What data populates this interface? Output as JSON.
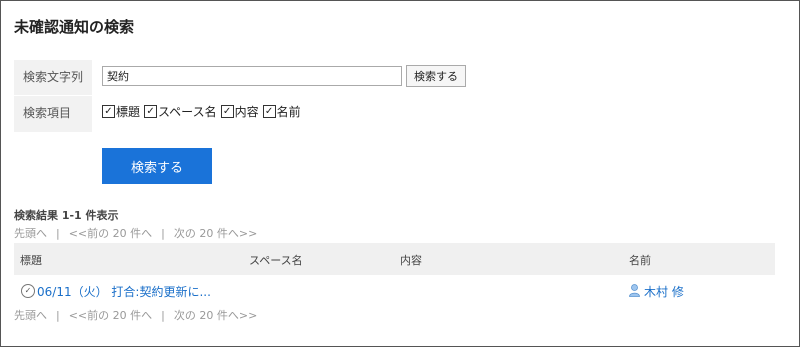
{
  "page": {
    "title": "未確認通知の検索"
  },
  "form": {
    "keyword_label": "検索文字列",
    "keyword_value": "契約",
    "inline_search_label": "検索する",
    "items_label": "検索項目",
    "checkboxes": [
      {
        "label": "標題",
        "checked": true
      },
      {
        "label": "スペース名",
        "checked": true
      },
      {
        "label": "内容",
        "checked": true
      },
      {
        "label": "名前",
        "checked": true
      }
    ],
    "search_button_label": "検索する"
  },
  "results": {
    "summary": "検索結果 1-1 件表示",
    "pager": {
      "first": "先頭へ",
      "prev": "<<前の 20 件へ",
      "next": "次の 20 件へ>>",
      "sep": "|"
    },
    "columns": [
      "標題",
      "スペース名",
      "内容",
      "名前"
    ],
    "rows": [
      {
        "title": "06/11（火） 打合:契約更新に...",
        "space": "",
        "content": "",
        "name": "木村 修"
      }
    ]
  },
  "icons": {
    "item": "schedule-icon",
    "user": "user-icon"
  },
  "colors": {
    "accent": "#1a73d9",
    "link": "#1a6fc9"
  }
}
